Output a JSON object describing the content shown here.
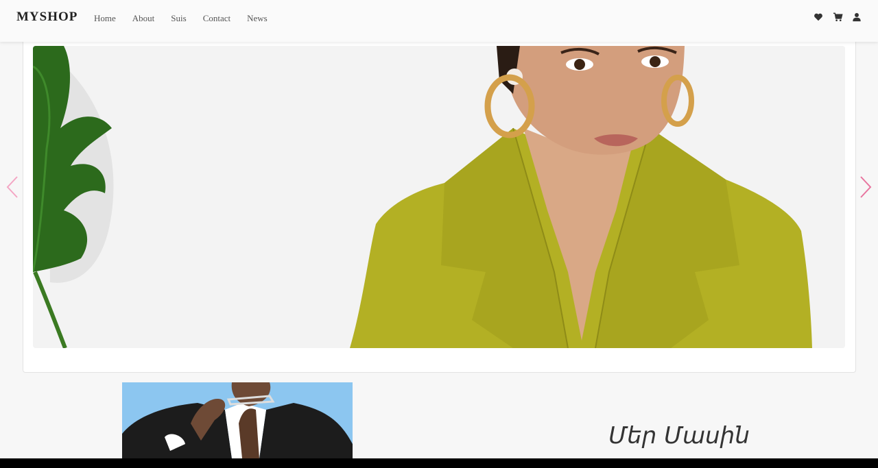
{
  "brand": "MYSHOP",
  "nav": {
    "links": [
      "Home",
      "About",
      "Suis",
      "Contact",
      "News"
    ]
  },
  "icons": {
    "wishlist": "heart-icon",
    "cart": "cart-icon",
    "account": "user-icon"
  },
  "carousel": {
    "prev": "chevron-left-icon",
    "next": "chevron-right-icon",
    "arrow_color": "#f4a6c4",
    "arrow_color_strong": "#e8759f"
  },
  "about": {
    "title": "Մեր Մասին"
  },
  "colors": {
    "coat": "#b3b024",
    "accent": "#f4a6c4"
  }
}
